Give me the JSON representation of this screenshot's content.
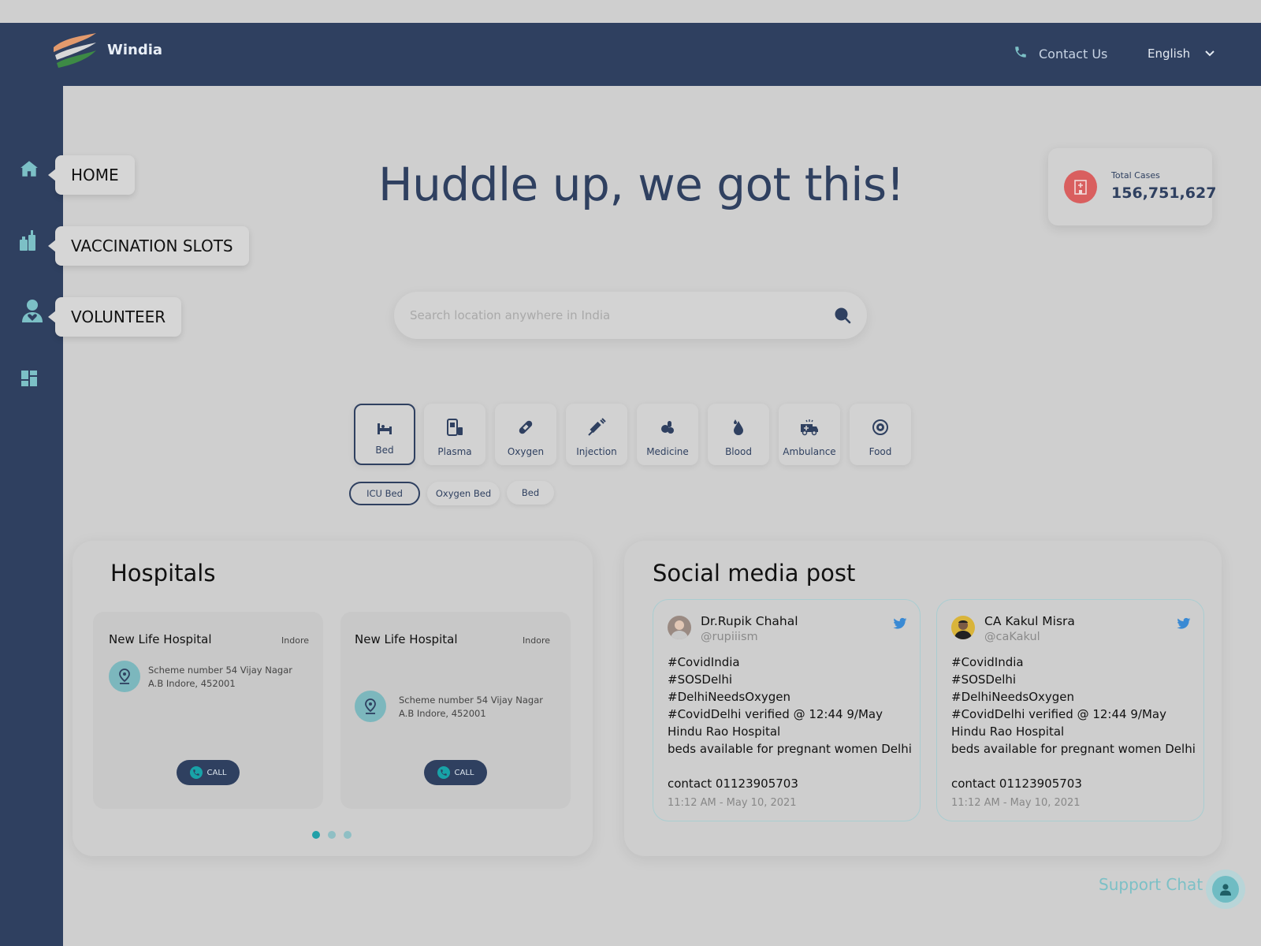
{
  "header": {
    "brand": "Windia",
    "contact_label": "Contact Us",
    "language": "English"
  },
  "sidebar": {
    "items": [
      {
        "label": "HOME",
        "icon": "home-icon"
      },
      {
        "label": "VACCINATION SLOTS",
        "icon": "vaccine-icon"
      },
      {
        "label": "VOLUNTEER",
        "icon": "volunteer-icon"
      },
      {
        "label": "",
        "icon": "dashboard-icon"
      }
    ]
  },
  "hero": {
    "title": "Huddle up, we got this!"
  },
  "stats": {
    "label": "Total Cases",
    "value": "156,751,627"
  },
  "search": {
    "placeholder": "Search location anywhere in India",
    "value": ""
  },
  "categories": [
    {
      "label": "Bed",
      "icon": "bed-icon",
      "active": true
    },
    {
      "label": "Plasma",
      "icon": "plasma-icon"
    },
    {
      "label": "Oxygen",
      "icon": "oxygen-icon"
    },
    {
      "label": "Injection",
      "icon": "injection-icon"
    },
    {
      "label": "Medicine",
      "icon": "medicine-icon"
    },
    {
      "label": "Blood",
      "icon": "blood-icon"
    },
    {
      "label": "Ambulance",
      "icon": "ambulance-icon"
    },
    {
      "label": "Food",
      "icon": "food-icon"
    }
  ],
  "subfilters": [
    {
      "label": "ICU Bed",
      "active": true
    },
    {
      "label": "Oxygen Bed"
    },
    {
      "label": "Bed"
    }
  ],
  "hospitals": {
    "title": "Hospitals",
    "cards": [
      {
        "name": "New Life Hospital",
        "city": "Indore",
        "address": "Scheme number 54 Vijay Nagar A.B Indore, 452001",
        "call_label": "CALL"
      },
      {
        "name": "New Life Hospital",
        "city": "Indore",
        "address": "Scheme number 54 Vijay Nagar A.B Indore, 452001",
        "call_label": "CALL"
      }
    ],
    "pager": {
      "count": 3,
      "active": 1
    }
  },
  "social": {
    "title": "Social media post",
    "posts": [
      {
        "name": "Dr.Rupik Chahal",
        "handle": "@rupiiism",
        "body": "#CovidIndia\n#SOSDelhi\n#DelhiNeedsOxygen\n#CovidDelhi verified @ 12:44 9/May\nHindu Rao Hospital\nbeds available for pregnant women Delhi\n\ncontact 01123905703",
        "time": "11:12 AM - May 10, 2021"
      },
      {
        "name": "CA Kakul Misra",
        "handle": "@caKakul",
        "body": "#CovidIndia\n#SOSDelhi\n#DelhiNeedsOxygen\n#CovidDelhi verified @ 12:44 9/May\nHindu Rao Hospital\nbeds available for pregnant women Delhi\n\ncontact 01123905703",
        "time": "11:12 AM - May 10, 2021"
      }
    ]
  },
  "support": {
    "label": "Support Chat"
  },
  "colors": {
    "navy": "#2f4060",
    "teal": "#20a0a8",
    "danger": "#d95f5f",
    "background": "#cfcfcf"
  }
}
